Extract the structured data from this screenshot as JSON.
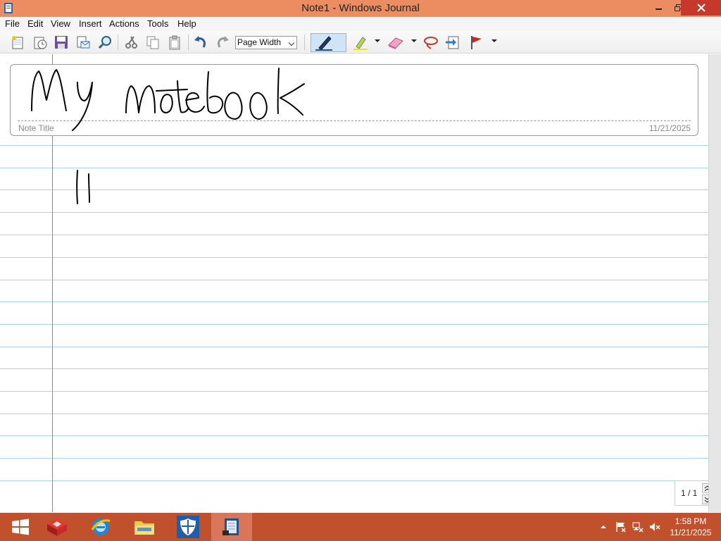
{
  "window": {
    "title": "Note1 - Windows Journal"
  },
  "menu": {
    "items": [
      "File",
      "Edit",
      "View",
      "Insert",
      "Actions",
      "Tools",
      "Help"
    ]
  },
  "toolbar": {
    "icons": [
      "new-note-icon",
      "open-icon",
      "save-icon",
      "send-mail-icon",
      "find-icon",
      "cut-icon",
      "copy-icon",
      "paste-icon",
      "undo-icon",
      "redo-icon",
      "pen-icon",
      "highlighter-icon",
      "eraser-icon",
      "lasso-icon",
      "insert-space-icon",
      "flag-icon"
    ],
    "zoom_value": "Page Width",
    "colors": {
      "pen_active_bg": "#cfe4f7",
      "highlighter": "#e8e800",
      "flag": "#d0281d"
    }
  },
  "note": {
    "title_label": "Note Title",
    "title_date": "11/21/2025",
    "handwritten_title": "My notebook",
    "page_counter": "1 / 1"
  },
  "taskbar": {
    "apps": [
      "start-icon",
      "virtualbox-icon",
      "internet-explorer-icon",
      "file-explorer-icon",
      "windows-defender-icon",
      "windows-journal-icon"
    ],
    "active_app": "windows-journal-icon",
    "clock_time": "1:58 PM",
    "clock_date": "11/21/2025",
    "colors": {
      "taskbar": "#c1502d",
      "titlebar": "#ec8d61",
      "ruled_line": "#a9d4ec"
    }
  }
}
